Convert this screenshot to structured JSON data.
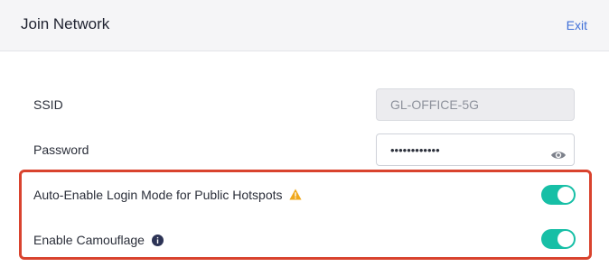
{
  "header": {
    "title": "Join Network",
    "exit_label": "Exit"
  },
  "form": {
    "ssid": {
      "label": "SSID",
      "value": "GL-OFFICE-5G"
    },
    "password": {
      "label": "Password",
      "masked_value": "••••••••••••",
      "visibility_icon": "eye-icon"
    },
    "auto_login": {
      "label": "Auto-Enable Login Mode for Public Hotspots",
      "icon": "warning-icon",
      "enabled": true
    },
    "camouflage": {
      "label": "Enable Camouflage",
      "icon": "info-icon",
      "enabled": true
    }
  },
  "colors": {
    "accent": "#17bfa6",
    "link": "#3f6fd8",
    "highlight_border": "#d9432e",
    "warning": "#f0a81c",
    "info": "#2c3355"
  }
}
